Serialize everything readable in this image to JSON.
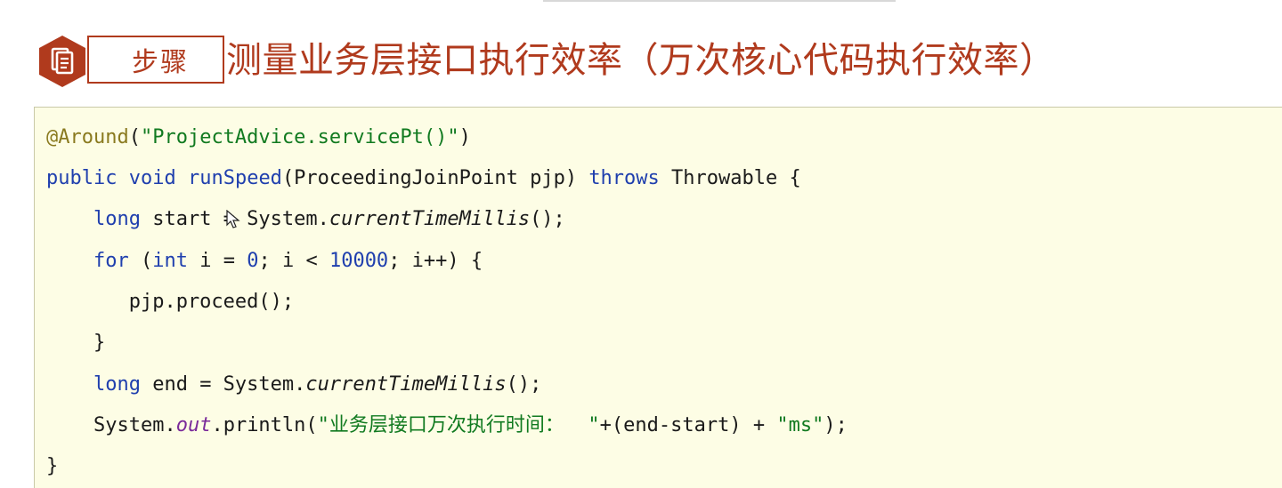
{
  "header": {
    "step_label": "步骤",
    "title": "测量业务层接口执行效率（万次核心代码执行效率）",
    "accent_color": "#b03a1d",
    "badge_icon": "document-icon"
  },
  "code": {
    "background_color": "#fdfde5",
    "lines": [
      {
        "tokens": [
          {
            "text": "@Around",
            "kind": "ann"
          },
          {
            "text": "(",
            "kind": "plain"
          },
          {
            "text": "\"ProjectAdvice.servicePt()\"",
            "kind": "str"
          },
          {
            "text": ")",
            "kind": "plain"
          }
        ]
      },
      {
        "tokens": [
          {
            "text": "public",
            "kind": "kw"
          },
          {
            "text": " ",
            "kind": "plain"
          },
          {
            "text": "void",
            "kind": "kw"
          },
          {
            "text": " ",
            "kind": "plain"
          },
          {
            "text": "runSpeed",
            "kind": "kw"
          },
          {
            "text": "(ProceedingJoinPoint pjp) ",
            "kind": "plain"
          },
          {
            "text": "throws",
            "kind": "kw"
          },
          {
            "text": " Throwable {",
            "kind": "plain"
          }
        ]
      },
      {
        "tokens": [
          {
            "text": "    ",
            "kind": "plain"
          },
          {
            "text": "long",
            "kind": "kw"
          },
          {
            "text": " start = System.",
            "kind": "plain"
          },
          {
            "text": "currentTimeMillis",
            "kind": "ital"
          },
          {
            "text": "();",
            "kind": "plain"
          }
        ]
      },
      {
        "tokens": [
          {
            "text": "    ",
            "kind": "plain"
          },
          {
            "text": "for",
            "kind": "kw"
          },
          {
            "text": " (",
            "kind": "plain"
          },
          {
            "text": "int",
            "kind": "kw"
          },
          {
            "text": " i = ",
            "kind": "plain"
          },
          {
            "text": "0",
            "kind": "num"
          },
          {
            "text": "; i < ",
            "kind": "plain"
          },
          {
            "text": "10000",
            "kind": "num"
          },
          {
            "text": "; i++) {",
            "kind": "plain"
          }
        ]
      },
      {
        "tokens": [
          {
            "text": "       pjp.proceed();",
            "kind": "plain"
          }
        ]
      },
      {
        "tokens": [
          {
            "text": "    }",
            "kind": "plain"
          }
        ]
      },
      {
        "tokens": [
          {
            "text": "    ",
            "kind": "plain"
          },
          {
            "text": "long",
            "kind": "kw"
          },
          {
            "text": " end = System.",
            "kind": "plain"
          },
          {
            "text": "currentTimeMillis",
            "kind": "ital"
          },
          {
            "text": "();",
            "kind": "plain"
          }
        ]
      },
      {
        "tokens": [
          {
            "text": "    System.",
            "kind": "plain"
          },
          {
            "text": "out",
            "kind": "ital-field"
          },
          {
            "text": ".println(",
            "kind": "plain"
          },
          {
            "text": "\"业务层接口万次执行时间：  \"",
            "kind": "str"
          },
          {
            "text": "+(end-start) + ",
            "kind": "plain"
          },
          {
            "text": "\"ms\"",
            "kind": "str"
          },
          {
            "text": ");",
            "kind": "plain"
          }
        ]
      },
      {
        "tokens": [
          {
            "text": "}",
            "kind": "plain"
          }
        ]
      }
    ]
  }
}
